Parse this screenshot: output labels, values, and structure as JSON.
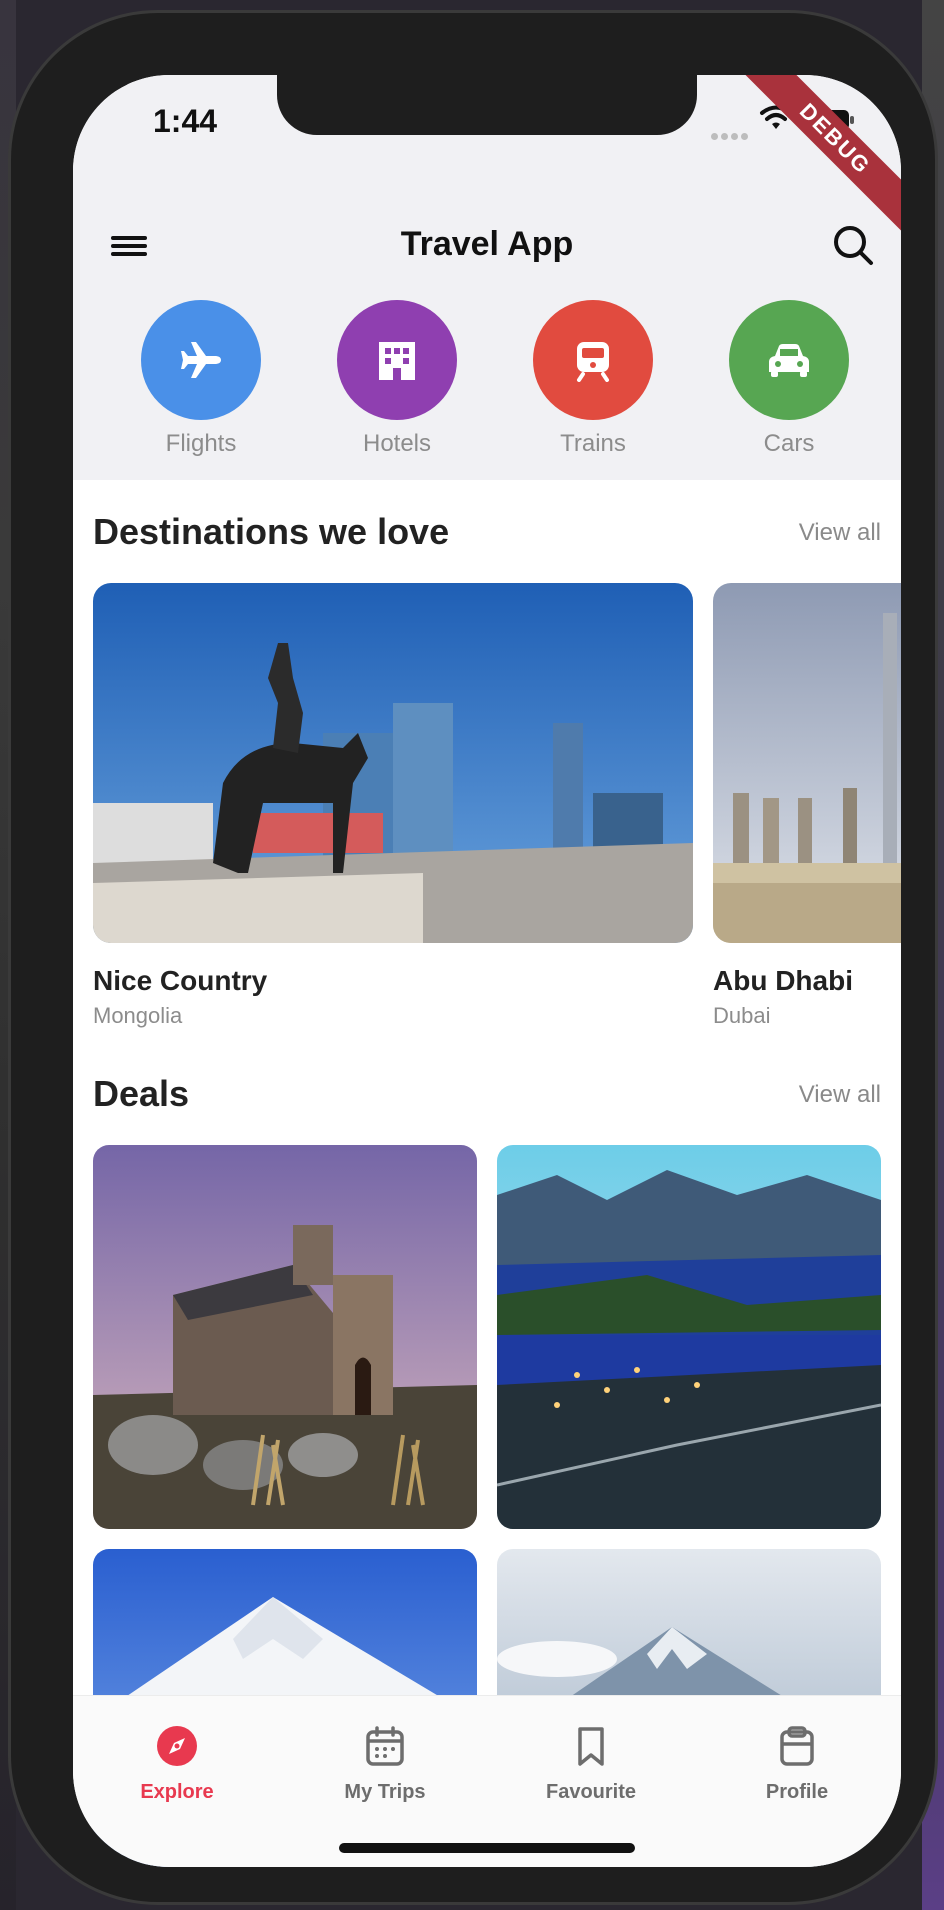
{
  "status": {
    "time": "1:44"
  },
  "debug_label": "DEBUG",
  "header": {
    "title": "Travel App"
  },
  "categories": [
    {
      "label": "Flights",
      "color": "#4a90e8",
      "icon": "airplane-icon"
    },
    {
      "label": "Hotels",
      "color": "#8f3fb0",
      "icon": "hotel-icon"
    },
    {
      "label": "Trains",
      "color": "#e14b3f",
      "icon": "train-icon"
    },
    {
      "label": "Cars",
      "color": "#57a652",
      "icon": "car-icon"
    }
  ],
  "destinations": {
    "title": "Destinations we love",
    "view_all": "View all",
    "items": [
      {
        "name": "Nice Country",
        "subtitle": "Mongolia"
      },
      {
        "name": "Abu Dhabi",
        "subtitle": "Dubai"
      }
    ]
  },
  "deals": {
    "title": "Deals",
    "view_all": "View all"
  },
  "tabs": [
    {
      "label": "Explore",
      "icon": "compass-icon",
      "active": true
    },
    {
      "label": "My Trips",
      "icon": "calendar-icon",
      "active": false
    },
    {
      "label": "Favourite",
      "icon": "bookmark-icon",
      "active": false
    },
    {
      "label": "Profile",
      "icon": "clipboard-icon",
      "active": false
    }
  ],
  "colors": {
    "accent": "#e8394f",
    "inactive": "#6d6d6d"
  }
}
